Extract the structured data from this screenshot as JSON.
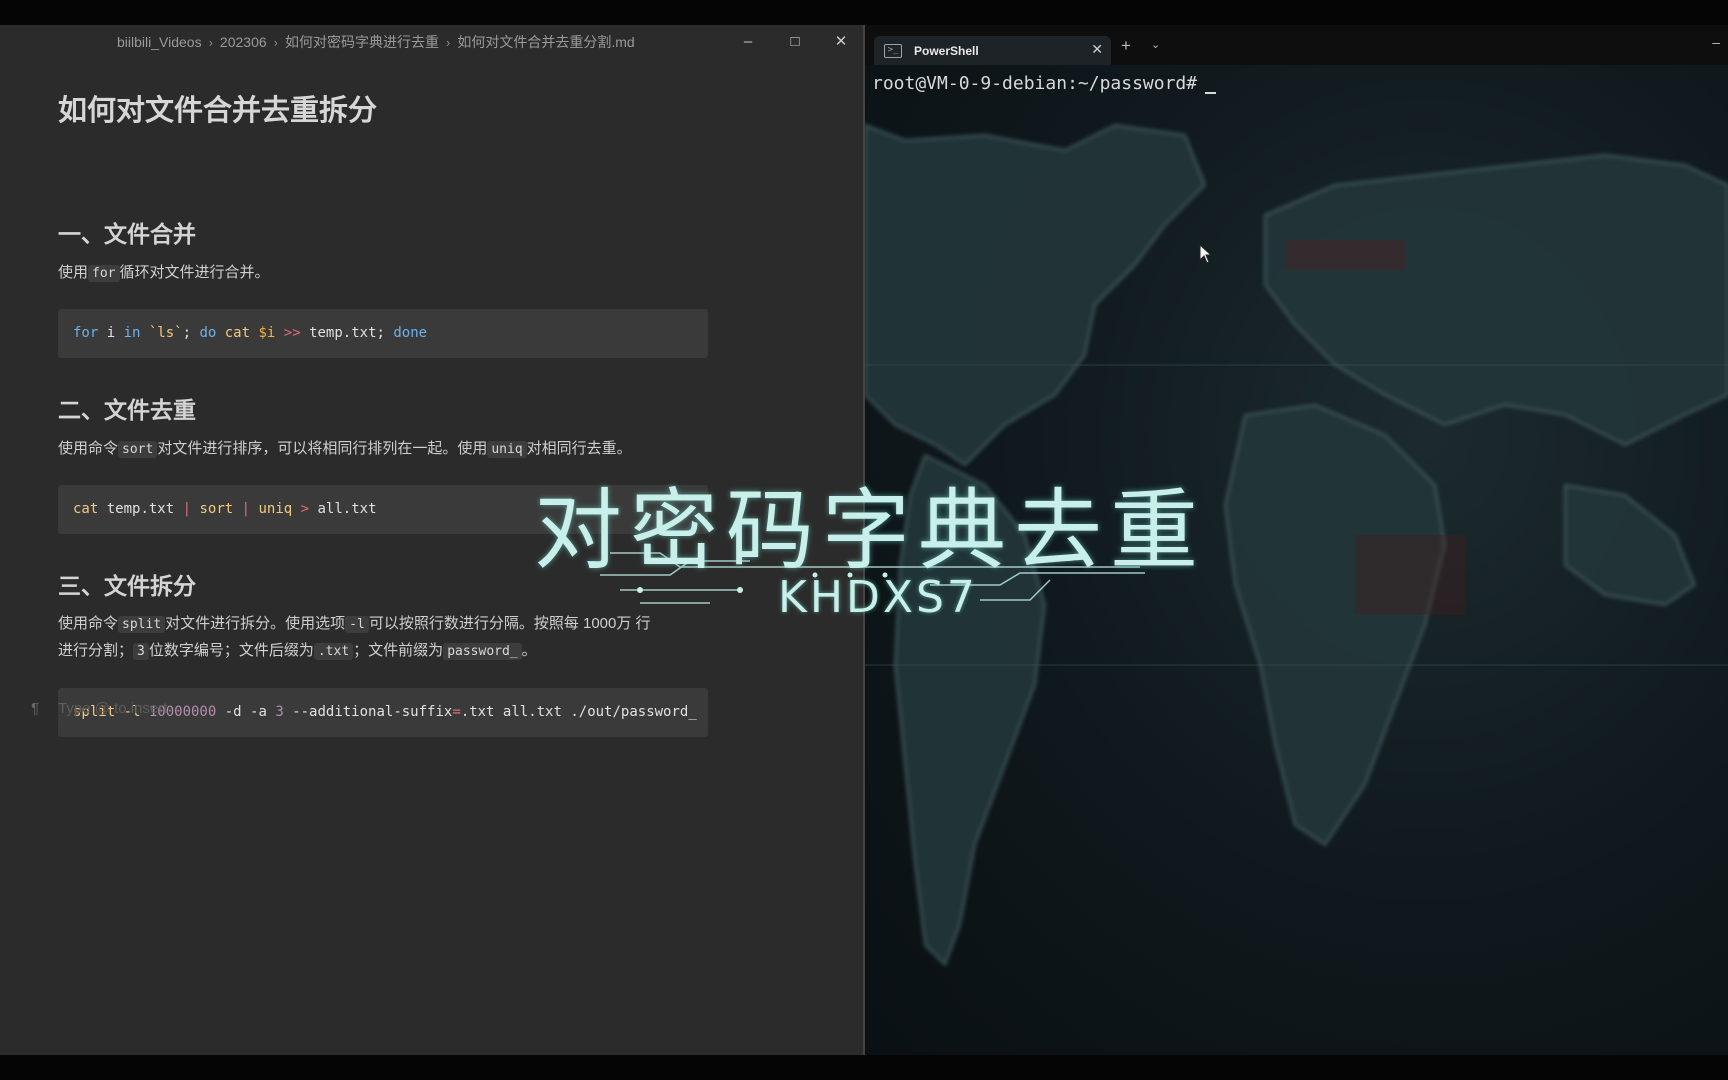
{
  "editor": {
    "breadcrumb": [
      "biilbili_Videos",
      "202306",
      "如何对密码字典进行去重",
      "如何对文件合并去重分割.md"
    ],
    "window_controls": {
      "minimize": "–",
      "maximize": "□",
      "close": "✕"
    },
    "doc": {
      "title": "如何对文件合并去重拆分",
      "section1": {
        "heading": "一、文件合并",
        "para": {
          "pre": "使用",
          "code": "for",
          "post": "循环对文件进行合并。"
        },
        "code": {
          "t1": "for",
          "t2": " i ",
          "t3": "in",
          "t4": " `ls`",
          "t5": "; ",
          "t6": "do",
          "t7": " cat ",
          "t8": "$i",
          "t9": " >> ",
          "t10": "temp.txt; ",
          "t11": "done"
        }
      },
      "section2": {
        "heading": "二、文件去重",
        "para": {
          "pre": "使用命令",
          "code1": "sort",
          "mid": "对文件进行排序，可以将相同行排列在一起。使用",
          "code2": "uniq",
          "post": "对相同行去重。"
        },
        "code": {
          "t1": "cat",
          "t2": " temp.txt ",
          "t3": "|",
          "t4": " sort ",
          "t5": "|",
          "t6": " uniq ",
          "t7": ">",
          "t8": " all.txt"
        }
      },
      "section3": {
        "heading": "三、文件拆分",
        "para": {
          "pre": "使用命令",
          "code1": "split",
          "mid1": "对文件进行拆分。使用选项",
          "code2": "-l",
          "mid2": "可以按照行数进行分隔。按照每 1000万 行",
          "line2_pre": "进行分割；",
          "code3": "3",
          "mid3": "位数字编号；文件后缀为",
          "code4": ".txt",
          "mid4": "；文件前缀为",
          "code5": "password_",
          "post": "。"
        },
        "code": {
          "t1": "split -l ",
          "t2": "10000000",
          "t3": " -d -a ",
          "t4": "3",
          "t5": " --additional-suffix",
          "t6": "=",
          "t7": ".txt all.txt ./out/password_"
        }
      },
      "insert_hint": "Type @ to insert",
      "pilcrow": "¶"
    }
  },
  "terminal": {
    "tab_title": "PowerShell",
    "tab_icon": ">_",
    "tab_close": "✕",
    "new_tab": "+",
    "dropdown": "⌄",
    "minimize": "–",
    "prompt": "root@VM-0-9-debian:~/password#"
  },
  "overlay": {
    "title": "对密码字典去重",
    "subtitle": "KHDXS7"
  },
  "colors": {
    "editor_bg": "#2b2b2b",
    "code_bg": "#3a3a3a",
    "keyword": "#6fb1e8",
    "overlay_text": "#c9efea"
  }
}
